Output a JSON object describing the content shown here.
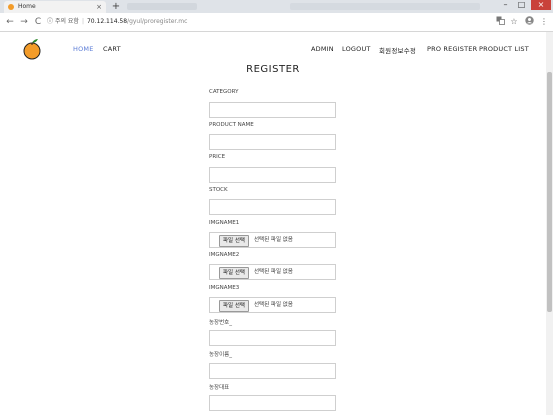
{
  "browser": {
    "tab_title": "Home",
    "tab_close": "×",
    "new_tab": "+",
    "security_label": "주의 요함",
    "url_host": "70.12.114.58",
    "url_path": "/gyul/proregister.mc",
    "back_glyph": "←",
    "forward_glyph": "→",
    "reload_glyph": "C",
    "info_glyph": "ⓘ",
    "win_min": "–",
    "win_max": "□",
    "win_close": "×"
  },
  "nav": {
    "left": [
      {
        "label": "HOME",
        "active": true
      },
      {
        "label": "CART",
        "active": false
      }
    ],
    "right": [
      {
        "label": "ADMIN"
      },
      {
        "label": "LOGOUT"
      },
      {
        "label": "회원정보수정"
      },
      {
        "label": "PRO REGISTER"
      },
      {
        "label": "PRODUCT LIST"
      }
    ]
  },
  "form": {
    "title": "REGISTER",
    "fields": [
      {
        "label": "CATEGORY",
        "type": "text",
        "value": ""
      },
      {
        "label": "PRODUCT NAME",
        "type": "text",
        "value": ""
      },
      {
        "label": "PRICE",
        "type": "text",
        "value": ""
      },
      {
        "label": "STOCK",
        "type": "text",
        "value": ""
      },
      {
        "label": "IMGNAME1",
        "type": "file",
        "button": "파일 선택",
        "status": "선택된 파일 없음"
      },
      {
        "label": "IMGNAME2",
        "type": "file",
        "button": "파일 선택",
        "status": "선택된 파일 없음"
      },
      {
        "label": "IMGNAME3",
        "type": "file",
        "button": "파일 선택",
        "status": "선택된 파일 없음"
      },
      {
        "label": "농장번호_",
        "type": "text",
        "value": ""
      },
      {
        "label": "농장이름_",
        "type": "text",
        "value": ""
      },
      {
        "label": "농장대표",
        "type": "text",
        "value": ""
      }
    ]
  },
  "colors": {
    "active_nav": "#5a7bd6",
    "logo": "#f39c2a"
  }
}
